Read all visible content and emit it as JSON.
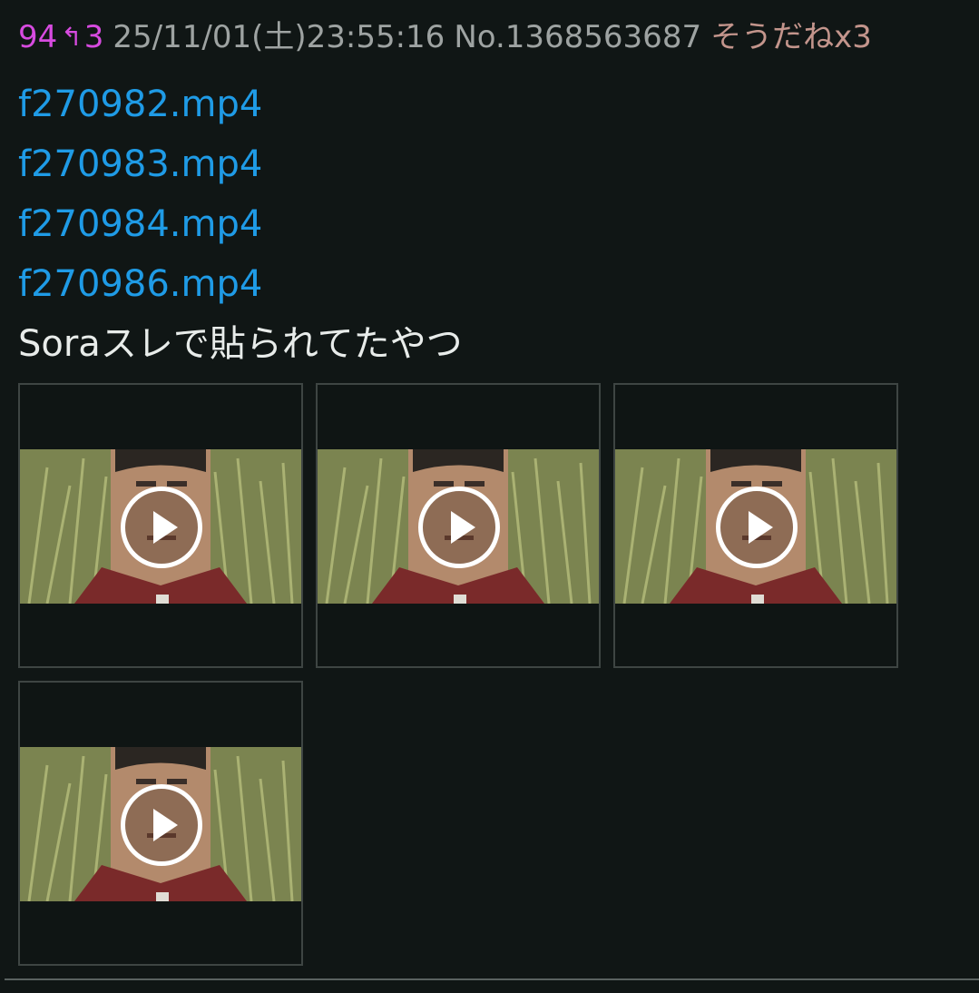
{
  "post": {
    "res_number": "94",
    "reply_icon": "reply-arrow-icon",
    "reply_count": "3",
    "datetime": "25/11/01(土)23:55:16",
    "post_no": "No.1368563687",
    "soudane": "そうだねx3",
    "files": [
      {
        "name": "f270982.mp4"
      },
      {
        "name": "f270983.mp4"
      },
      {
        "name": "f270984.mp4"
      },
      {
        "name": "f270986.mp4"
      }
    ],
    "comment": "Soraスレで貼られてたやつ",
    "thumbnails": [
      {
        "icon": "play-icon"
      },
      {
        "icon": "play-icon"
      },
      {
        "icon": "play-icon"
      },
      {
        "icon": "play-icon"
      }
    ]
  },
  "colors": {
    "background": "#101615",
    "res_number": "#d74be0",
    "meta_text": "#9ea3a2",
    "soudane": "#c3958c",
    "link": "#1f9be6",
    "comment": "#e8ecea"
  }
}
